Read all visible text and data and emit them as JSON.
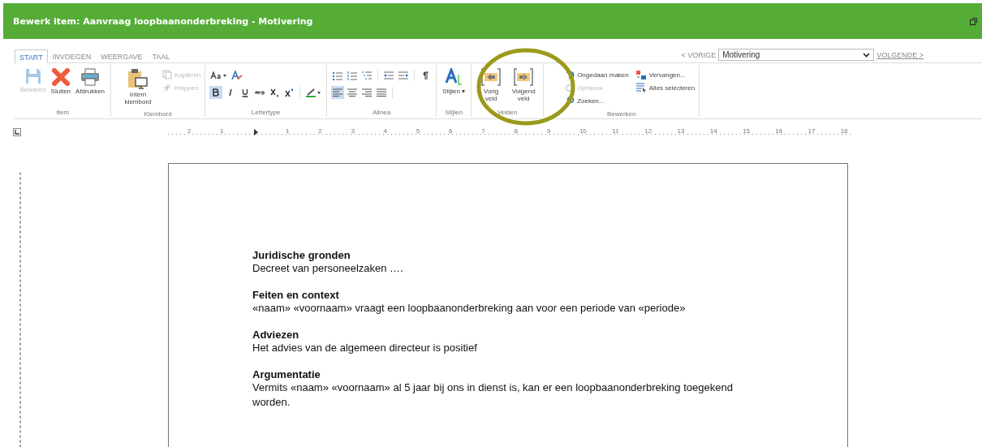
{
  "window": {
    "title": "Bewerk item: Aanvraag loopbaanonderbreking - Motivering"
  },
  "tabs": [
    {
      "label": "START",
      "selected": true
    },
    {
      "label": "INVOEGEN",
      "selected": false
    },
    {
      "label": "WEERGAVE",
      "selected": false
    },
    {
      "label": "TAAL",
      "selected": false
    }
  ],
  "navigation": {
    "previous": "< VORIGE",
    "field": "Motivering",
    "next": "VOLGENDE >"
  },
  "groups": [
    {
      "label": "Item",
      "buttons": [
        {
          "label": "Bewaren",
          "disabled": true
        },
        {
          "label": "Sluiten",
          "disabled": false
        },
        {
          "label": "Afdrukken",
          "disabled": false
        }
      ]
    },
    {
      "label": "Klembord",
      "buttons": [
        {
          "label": "Intern klembord",
          "disabled": false
        }
      ],
      "small": [
        {
          "label": "Kopiëren",
          "disabled": true
        },
        {
          "label": "Knippen",
          "disabled": true
        }
      ]
    },
    {
      "label": "Lettertype",
      "kind": "font"
    },
    {
      "label": "Alinea",
      "kind": "paragraph"
    },
    {
      "label": "Stijlen",
      "buttons": [
        {
          "label": "Stijlen ▾",
          "disabled": false
        }
      ]
    },
    {
      "label": "Velden",
      "buttons": [
        {
          "label": "Vorig veld",
          "disabled": false
        },
        {
          "label": "Volgend veld",
          "disabled": false
        }
      ]
    },
    {
      "label": "Bewerken",
      "small": [
        {
          "label": "Ongedaan maken",
          "disabled": false
        },
        {
          "label": "Opnieuw",
          "disabled": true
        },
        {
          "label": "Zoeken...",
          "disabled": false
        },
        {
          "label": "Vervangen...",
          "disabled": false
        },
        {
          "label": "Alles selecteren",
          "disabled": false
        }
      ]
    }
  ],
  "ruler": {
    "labels": [
      "2",
      "1",
      "1",
      "2",
      "3",
      "4",
      "5",
      "6",
      "7",
      "8",
      "9",
      "10",
      "11",
      "12",
      "13",
      "14",
      "15",
      "16",
      "17",
      "18"
    ]
  },
  "document": {
    "sections": [
      {
        "heading": "Juridische gronden",
        "text": "Decreet van personeelzaken …."
      },
      {
        "heading": "Feiten en context",
        "text": "«naam» «voornaam» vraagt een loopbaanonderbreking aan voor een periode van «periode»"
      },
      {
        "heading": "Adviezen",
        "text": "Het advies van de algemeen directeur is positief"
      },
      {
        "heading": "Argumentatie",
        "text": "Vermits «naam» «voornaam» al 5 jaar bij ons in dienst is, kan er een loopbaanonderbreking toegekend worden."
      }
    ]
  }
}
